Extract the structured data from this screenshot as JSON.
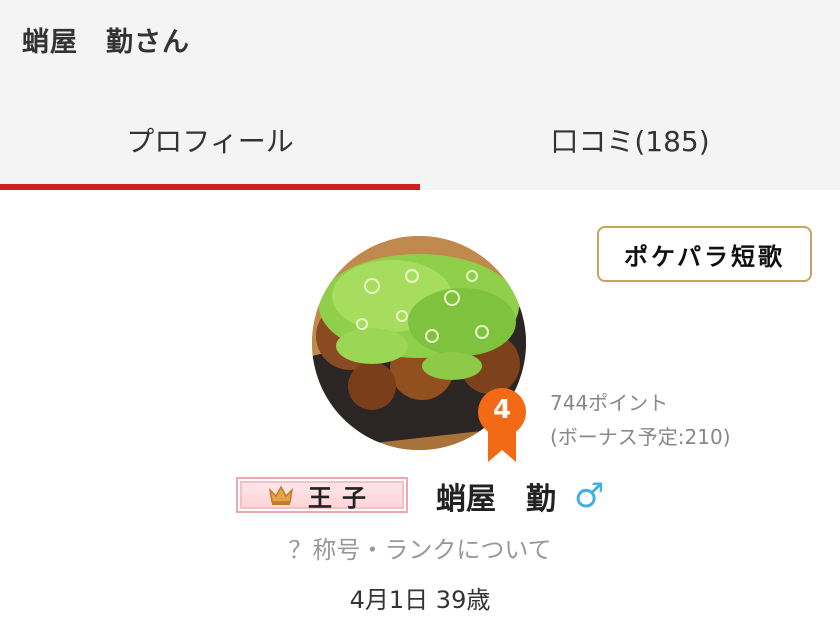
{
  "header": {
    "username": "蛸屋　勤さん"
  },
  "tabs": [
    {
      "label": "プロフィール",
      "active": true
    },
    {
      "label": "口コミ(185)",
      "active": false
    }
  ],
  "accent_color": "#cc1f1f",
  "tanka_button": {
    "label": "ポケパラ短歌"
  },
  "rank": {
    "level": "4",
    "badge_color": "#f26a16"
  },
  "points": {
    "total": "744ポイント",
    "bonus": "(ボーナス予定:210)"
  },
  "title_badge": {
    "icon": "crown-icon",
    "text": "王子"
  },
  "user": {
    "name": "蛸屋　勤",
    "gender_symbol": "♂"
  },
  "rank_help_link": "？称号・ランクについて",
  "profile": {
    "birthday_age": "4月1日 39歳"
  }
}
